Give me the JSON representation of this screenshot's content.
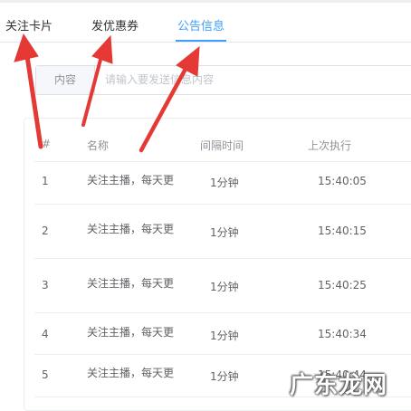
{
  "tabs": [
    {
      "label": "关注卡片",
      "active": false
    },
    {
      "label": "发优惠券",
      "active": false
    },
    {
      "label": "公告信息",
      "active": true
    }
  ],
  "form": {
    "addon_label": "内容",
    "content_placeholder": "请输入要发送信息内容"
  },
  "table": {
    "headers": [
      "#",
      "名称",
      "间隔时间",
      "上次执行"
    ],
    "rows": [
      {
        "index": "1",
        "name": "关注主播，每天更",
        "interval": "1分钟",
        "last_run": "15:40:05"
      },
      {
        "index": "2",
        "name": "关注主播，每天更",
        "interval": "1分钟",
        "last_run": "15:40:15"
      },
      {
        "index": "3",
        "name": "关注主播，每天更",
        "interval": "1分钟",
        "last_run": "15:40:25"
      },
      {
        "index": "4",
        "name": "关注主播，每天更",
        "interval": "1分钟",
        "last_run": "15:40:34"
      },
      {
        "index": "5",
        "name": "关注主播，每天更",
        "interval": "1分钟",
        "last_run": "15:40:44"
      }
    ]
  },
  "watermark": "广东龙网",
  "colors": {
    "accent": "#409eff",
    "annotation_arrow": "#e53935"
  }
}
